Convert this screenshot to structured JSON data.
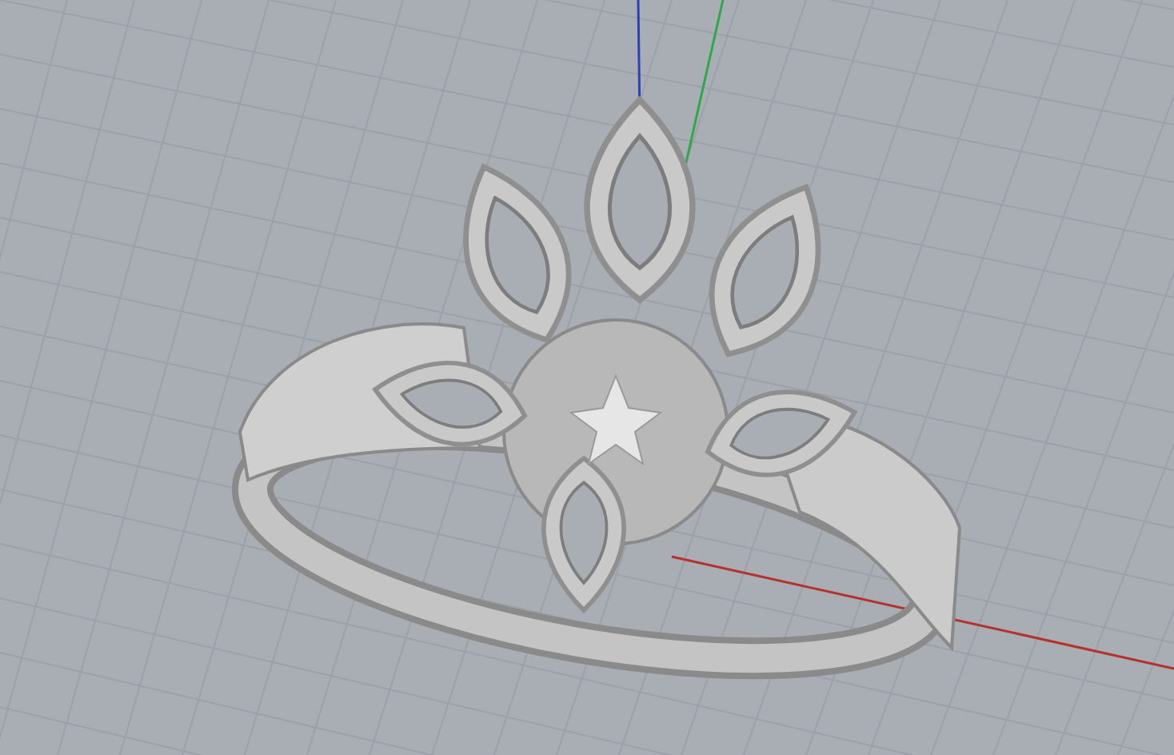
{
  "viewport": {
    "grid": true
  },
  "axes": [
    {
      "kind": "x",
      "color": "#b5322c"
    },
    {
      "kind": "y",
      "color": "#2fa84a"
    },
    {
      "kind": "z",
      "color": "#2d3fc0"
    }
  ]
}
